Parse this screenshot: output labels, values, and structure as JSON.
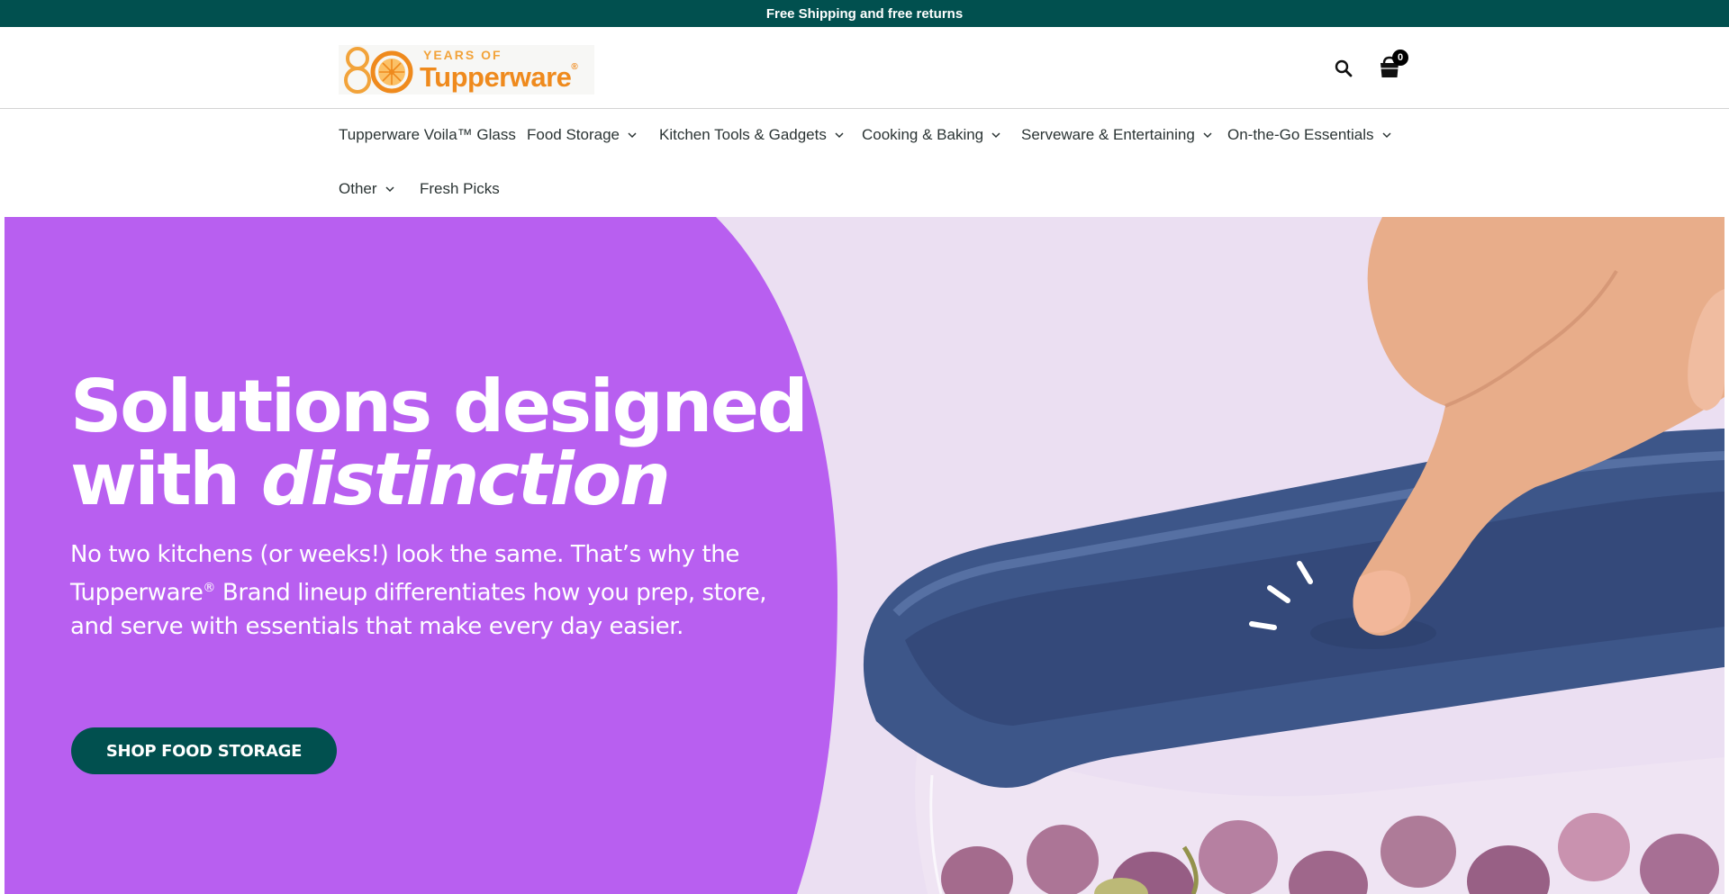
{
  "announcement": {
    "text": "Free Shipping and free returns"
  },
  "header": {
    "logo": {
      "years_text": "YEARS OF",
      "brand": "Tupperware",
      "registered": "®"
    },
    "cart": {
      "count": "0"
    }
  },
  "nav": {
    "items": [
      {
        "label": "Tupperware Voila™ Glass",
        "has_dropdown": false
      },
      {
        "label": "Food Storage",
        "has_dropdown": true
      },
      {
        "label": "Kitchen Tools & Gadgets",
        "has_dropdown": true
      },
      {
        "label": "Cooking & Baking",
        "has_dropdown": true
      },
      {
        "label": "Serveware & Entertaining",
        "has_dropdown": true
      },
      {
        "label": "On-the-Go Essentials",
        "has_dropdown": true
      },
      {
        "label": "Other",
        "has_dropdown": true
      },
      {
        "label": "Fresh Picks",
        "has_dropdown": false
      }
    ]
  },
  "hero": {
    "title_line1": "Solutions designed",
    "title_line2_plain": "with ",
    "title_line2_italic": "distinction",
    "subtitle_part1": "No two kitchens (or weeks!) look the same. That’s why the Tupperware",
    "subtitle_reg": "®",
    "subtitle_part2": " Brand lineup differentiates how you prep, store, and serve with essentials that make every day easier.",
    "cta_label": "SHOP FOOD STORAGE"
  },
  "colors": {
    "announcement_bg": "#01504f",
    "hero_purple": "#b85ff0",
    "hero_bg": "#ebdff2",
    "lid_navy": "#3d5689",
    "cta_bg": "#01504f",
    "logo_orange": "#ef8a1d"
  },
  "icons": [
    "search-icon",
    "shopping-bag-icon",
    "chevron-down-icon"
  ]
}
